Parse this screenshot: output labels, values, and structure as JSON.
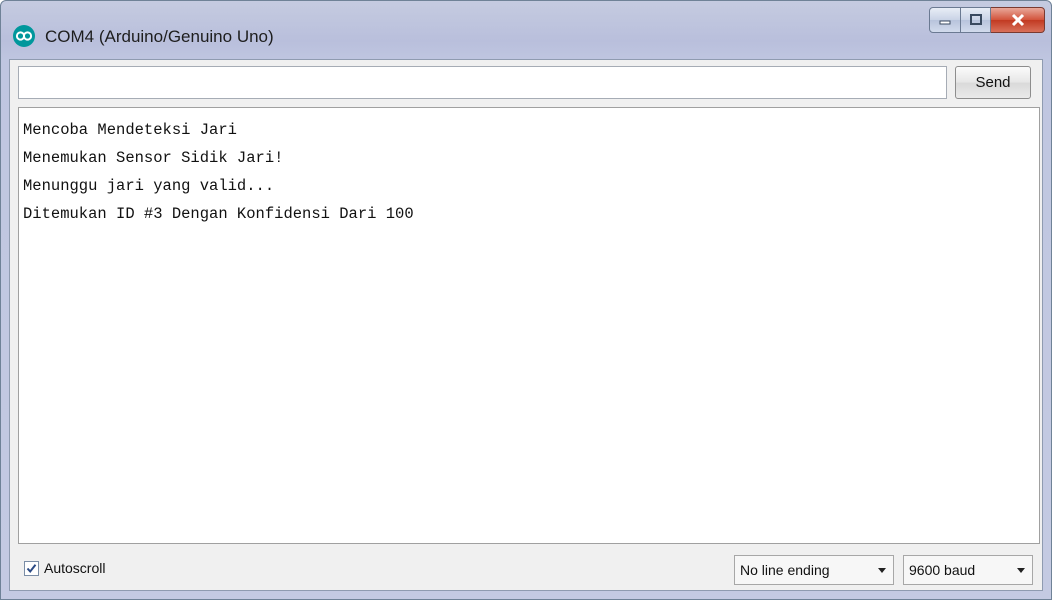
{
  "window": {
    "title": "COM4 (Arduino/Genuino Uno)",
    "icon": "arduino-icon",
    "controls": [
      "minimize-icon",
      "maximize-icon",
      "close-icon"
    ]
  },
  "input": {
    "value": "",
    "placeholder": "",
    "send_label": "Send"
  },
  "output": {
    "lines": [
      "Mencoba Mendeteksi Jari",
      "Menemukan Sensor Sidik Jari!",
      "Menunggu jari yang valid...",
      "Ditemukan ID #3 Dengan Konfidensi Dari 100"
    ]
  },
  "footer": {
    "autoscroll_label": "Autoscroll",
    "autoscroll_checked": true,
    "line_ending": "No line ending",
    "baud_rate": "9600 baud"
  },
  "colors": {
    "arduino_teal": "#00979c",
    "close_red": "#c23a22",
    "titlebar": "#bfc6e0"
  }
}
